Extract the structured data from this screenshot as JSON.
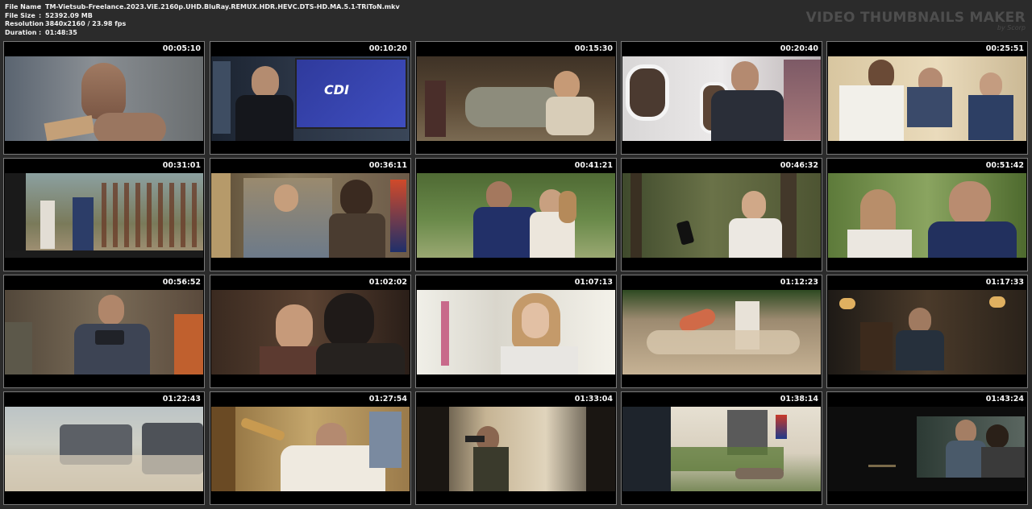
{
  "info": {
    "file_name_label": "File Name",
    "file_name": "TM-Vietsub-Freelance.2023.ViE.2160p.UHD.BluRay.REMUX.HDR.HEVC.DTS-HD.MA.5.1-TRiToN.mkv",
    "file_size_label": "File Size",
    "file_size": "52392.09 MB",
    "resolution_label": "Resolution",
    "resolution": "3840x2160 / 23.98 fps",
    "duration_label": "Duration",
    "duration": "01:48:35",
    "separator": ":"
  },
  "brand": {
    "title": "VIDEO THUMBNAILS MAKER",
    "subtitle": "by Scorp"
  },
  "thumbnails": [
    {
      "time": "00:05:10"
    },
    {
      "time": "00:10:20"
    },
    {
      "time": "00:15:30"
    },
    {
      "time": "00:20:40"
    },
    {
      "time": "00:25:51"
    },
    {
      "time": "00:31:01"
    },
    {
      "time": "00:36:11"
    },
    {
      "time": "00:41:21"
    },
    {
      "time": "00:46:32"
    },
    {
      "time": "00:51:42"
    },
    {
      "time": "00:56:52"
    },
    {
      "time": "01:02:02"
    },
    {
      "time": "01:07:13"
    },
    {
      "time": "01:12:23"
    },
    {
      "time": "01:17:33"
    },
    {
      "time": "01:22:43"
    },
    {
      "time": "01:27:54"
    },
    {
      "time": "01:33:04"
    },
    {
      "time": "01:38:14"
    },
    {
      "time": "01:43:24"
    }
  ],
  "scene_logo_text": "CDI"
}
